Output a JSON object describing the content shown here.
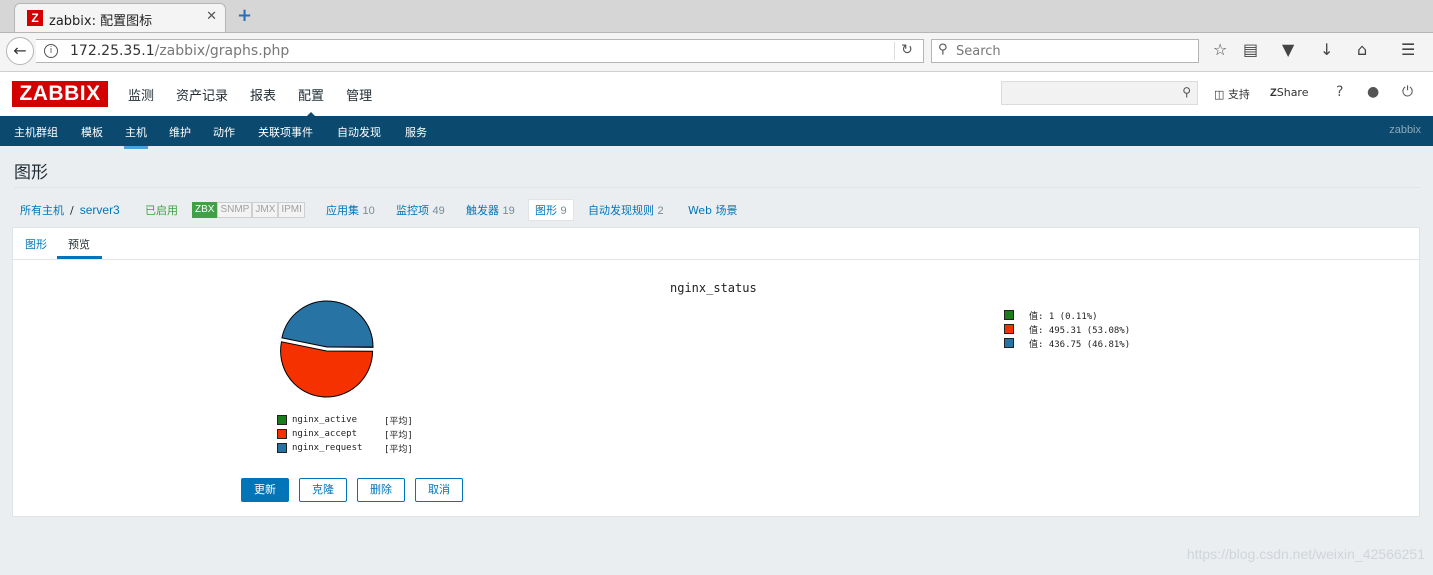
{
  "browser": {
    "tab_title": "zabbix: 配置图标",
    "tab_favicon": "Z",
    "tab_close": "✕",
    "new_tab": "+",
    "url_host": "172.25.35.1",
    "url_path": "/zabbix/graphs.php",
    "search_placeholder": "Search"
  },
  "header": {
    "logo": "ZABBIX",
    "menu": [
      "监测",
      "资产记录",
      "报表",
      "配置",
      "管理"
    ],
    "active_menu": "配置",
    "support": "支持",
    "share": "Share",
    "help": "?"
  },
  "subnav": {
    "items": [
      "主机群组",
      "模板",
      "主机",
      "维护",
      "动作",
      "关联项事件",
      "自动发现",
      "服务"
    ],
    "active": "主机",
    "brand": "zabbix"
  },
  "page": {
    "title": "图形",
    "breadcrumb": {
      "all_hosts": "所有主机",
      "sep": "/",
      "host": "server3",
      "status": "已启用",
      "availability": [
        "ZBX",
        "SNMP",
        "JMX",
        "IPMI"
      ],
      "links": [
        {
          "label": "应用集",
          "count": "10"
        },
        {
          "label": "监控项",
          "count": "49"
        },
        {
          "label": "触发器",
          "count": "19"
        },
        {
          "label": "图形",
          "count": "9"
        },
        {
          "label": "自动发现规则",
          "count": "2"
        },
        {
          "label": "Web 场景",
          "count": ""
        }
      ]
    },
    "tabs": [
      "图形",
      "预览"
    ],
    "active_tab": "预览"
  },
  "chart_data": {
    "type": "pie",
    "title": "nginx_status",
    "slices": [
      {
        "name": "nginx_active",
        "agg": "[平均]",
        "value": 1,
        "percent": 0.11,
        "color": "#1a7c1a"
      },
      {
        "name": "nginx_accept",
        "agg": "[平均]",
        "value": 495.31,
        "percent": 53.08,
        "color": "#f63100"
      },
      {
        "name": "nginx_request",
        "agg": "[平均]",
        "value": 436.75,
        "percent": 46.81,
        "color": "#2774a4"
      }
    ],
    "value_lines": [
      "值: 1 (0.11%)",
      "值: 495.31 (53.08%)",
      "值: 436.75 (46.81%)"
    ]
  },
  "buttons": {
    "update": "更新",
    "clone": "克隆",
    "delete": "删除",
    "cancel": "取消"
  },
  "watermark": "https://blog.csdn.net/weixin_42566251"
}
